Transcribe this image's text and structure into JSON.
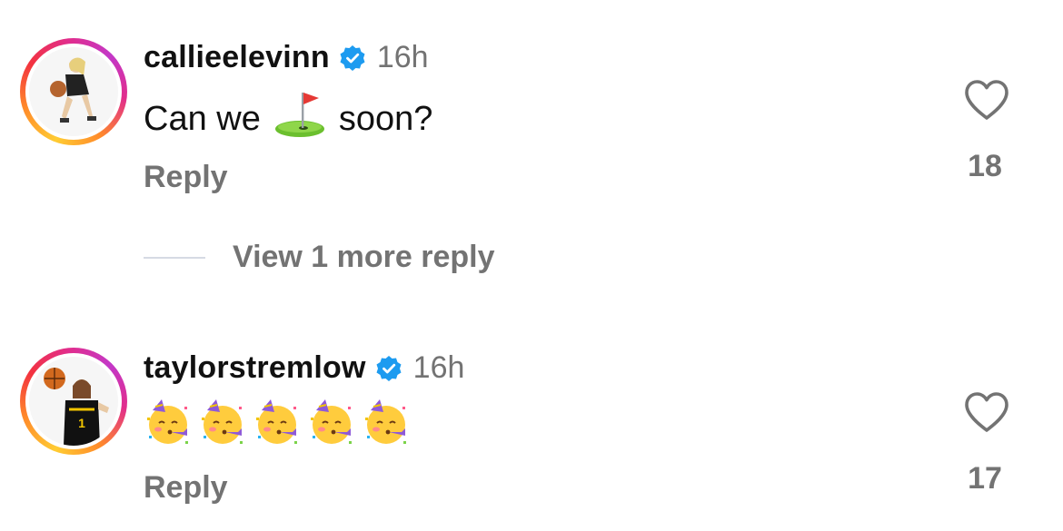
{
  "comments": [
    {
      "username": "callieelevinn",
      "time": "16h",
      "text_before": "Can we",
      "text_emoji": "golf-flag-emoji",
      "text_after": "soon?",
      "reply_label": "Reply",
      "likes": "18"
    },
    {
      "username": "taylorstremlow",
      "time": "16h",
      "emoji": [
        "partying-face-emoji",
        "partying-face-emoji",
        "partying-face-emoji",
        "partying-face-emoji",
        "partying-face-emoji"
      ],
      "reply_label": "Reply",
      "likes": "17"
    }
  ],
  "view_more": {
    "label": "View 1 more reply"
  },
  "colors": {
    "verified": "#1d9bf0",
    "muted": "#737373",
    "text": "#111111"
  }
}
